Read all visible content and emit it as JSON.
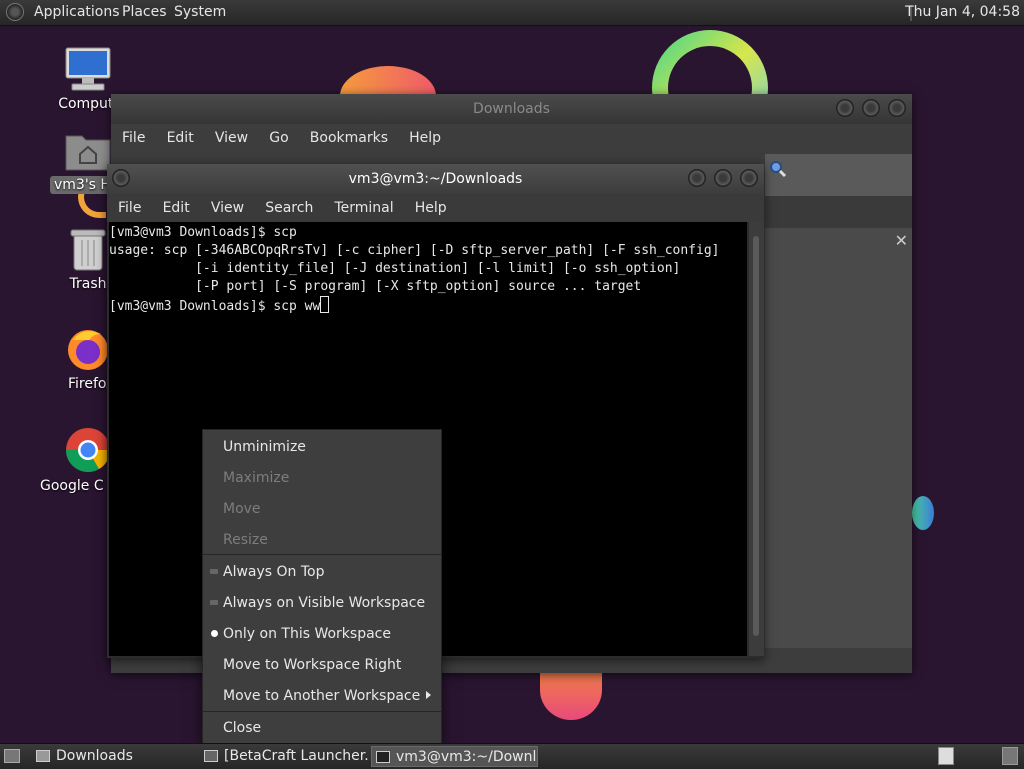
{
  "top_panel": {
    "menus": [
      "Applications",
      "Places",
      "System"
    ],
    "clock": "Thu Jan  4, 04:58"
  },
  "desktop": {
    "icons": [
      {
        "label": "Computer",
        "icon": "computer-icon"
      },
      {
        "label": "vm3's Home",
        "icon": "home-folder-icon"
      },
      {
        "label": "Trash",
        "icon": "trash-icon"
      },
      {
        "label": "Firefox",
        "icon": "firefox-icon"
      },
      {
        "label": "Google Chrome",
        "icon": "chrome-icon"
      }
    ]
  },
  "file_manager": {
    "title": "Downloads",
    "menu": [
      "File",
      "Edit",
      "View",
      "Go",
      "Bookmarks",
      "Help"
    ]
  },
  "terminal": {
    "title": "vm3@vm3:~/Downloads",
    "menu": [
      "File",
      "Edit",
      "View",
      "Search",
      "Terminal",
      "Help"
    ],
    "lines": [
      "[vm3@vm3 Downloads]$ scp",
      "usage: scp [-346ABCOpqRrsTv] [-c cipher] [-D sftp_server_path] [-F ssh_config]",
      "           [-i identity_file] [-J destination] [-l limit] [-o ssh_option]",
      "           [-P port] [-S program] [-X sftp_option] source ... target"
    ],
    "prompt": "[vm3@vm3 Downloads]$ scp ww"
  },
  "context_menu": {
    "items": [
      {
        "label": "Unminimize",
        "enabled": true
      },
      {
        "label": "Maximize",
        "enabled": false
      },
      {
        "label": "Move",
        "enabled": false
      },
      {
        "label": "Resize",
        "enabled": false
      },
      {
        "label": "Always On Top",
        "enabled": true,
        "mark": "radio-off"
      },
      {
        "label": "Always on Visible Workspace",
        "enabled": true,
        "mark": "radio-off"
      },
      {
        "label": "Only on This Workspace",
        "enabled": true,
        "mark": "radio-on"
      },
      {
        "label": "Move to Workspace Right",
        "enabled": true
      },
      {
        "label": "Move to Another Workspace",
        "enabled": true,
        "submenu": true
      },
      {
        "label": "Close",
        "enabled": true
      }
    ]
  },
  "taskbar": {
    "tasks": [
      {
        "label": "Downloads",
        "active": false,
        "icon": "folder-icon"
      },
      {
        "label": "[BetaCraft Launcher...",
        "active": false,
        "icon": "app-icon"
      },
      {
        "label": "vm3@vm3:~/Downl...",
        "active": true,
        "icon": "terminal-icon"
      }
    ]
  }
}
